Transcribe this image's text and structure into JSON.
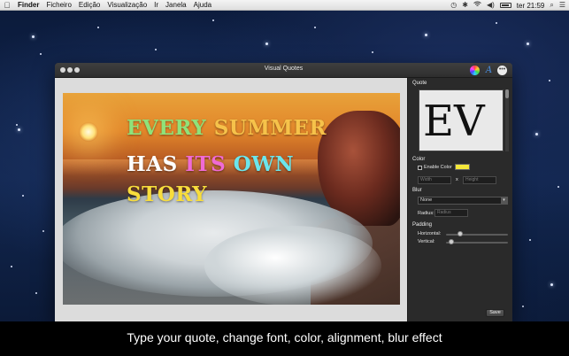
{
  "menubar": {
    "apple_icon": "apple-icon",
    "app_name": "Finder",
    "menus": [
      "Ficheiro",
      "Edição",
      "Visualização",
      "Ir",
      "Janela",
      "Ajuda"
    ],
    "time": "ter 21:59",
    "status_icons": [
      "time-machine-icon",
      "bluetooth-icon",
      "wifi-icon",
      "volume-icon",
      "battery-icon",
      "search-icon",
      "list-icon"
    ]
  },
  "window": {
    "title": "Visual Quotes",
    "toolbar_icons": [
      "color-wheel-icon",
      "font-icon",
      "more-icon"
    ]
  },
  "quote": {
    "lines": [
      [
        {
          "text": "EVERY ",
          "color": "#8fe27a"
        },
        {
          "text": "SUMMER",
          "color": "#f6c24a"
        }
      ],
      [
        {
          "text": "HAS ",
          "color": "#ffffff"
        },
        {
          "text": "ITS ",
          "color": "#f06ad6"
        },
        {
          "text": "OWN",
          "color": "#6be6ec"
        }
      ],
      [
        {
          "text": "STORY",
          "color": "#f8dd3c"
        }
      ]
    ]
  },
  "inspector": {
    "quote_label": "Quote",
    "font_preview": "EV",
    "color_label": "Color",
    "enable_color_label": "Enable Color",
    "enable_color_checked": false,
    "color_value": "#f5e83a",
    "width_placeholder": "Width",
    "times": "x",
    "height_placeholder": "Height",
    "blur_label": "Blur",
    "blur_value": "None",
    "radius_label": "Radius:",
    "radius_placeholder": "Radius",
    "padding_label": "Padding",
    "horizontal_label": "Horizontal:",
    "horizontal_value": 0.2,
    "vertical_label": "Vertical:",
    "vertical_value": 0.05,
    "save_label": "Save"
  },
  "caption": "Type your quote, change font, color, alignment, blur effect"
}
